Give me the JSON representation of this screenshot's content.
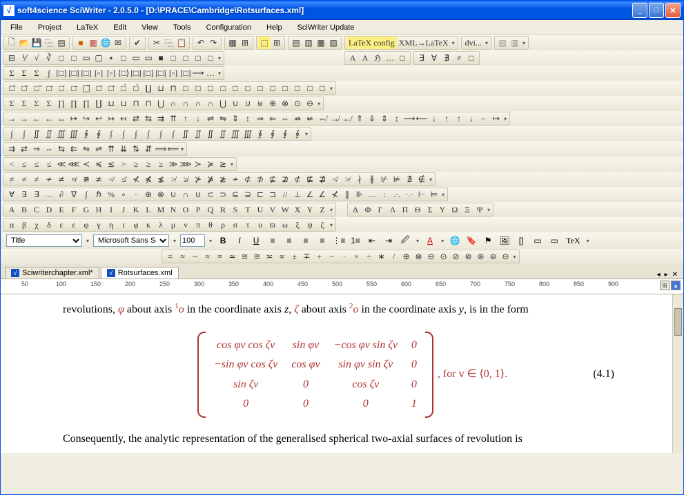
{
  "window": {
    "title": "soft4science SciWriter  -  2.0.5.0 -   [D:\\PRACE\\Cambridge\\Rotsurfaces.xml]"
  },
  "menu": {
    "items": [
      "File",
      "Project",
      "LaTeX",
      "Edit",
      "View",
      "Tools",
      "Configuration",
      "Help",
      "SciWriter Update"
    ]
  },
  "toolbar_main": {
    "latex_config": "LaTeX config",
    "xml_latex": "XML→LaTeX",
    "dvi": "dvi..."
  },
  "symbol_rows": [
    [
      "⊟",
      "⅟",
      "√",
      "∛",
      "□",
      "□",
      "▭",
      "▢",
      "▪",
      "□",
      "▭",
      "▭",
      "■",
      "□",
      "□",
      "□",
      "□"
    ],
    [
      "Σ",
      "Σ",
      "Σ",
      "∫",
      "[□]",
      "[□]",
      "[□]",
      "[▫]",
      "[▫]",
      "⟨□⟩",
      "[□]",
      "[□]",
      "[□]",
      "[▫]",
      "[□]",
      "⟶",
      "…"
    ],
    [
      "□̂",
      "□̌",
      "□̃",
      "□̄",
      "□̇",
      "□̈",
      "□⃗",
      "□̆",
      "□̊",
      "□́",
      "□̀",
      "∐",
      "⊔",
      "⊓",
      "□",
      "□",
      "□",
      "□",
      "□",
      "□",
      "□",
      "□",
      "□",
      "□",
      "□",
      "□"
    ],
    [
      "Σ",
      "Σ",
      "Σ",
      "Σ",
      "∏",
      "∏",
      "∏",
      "∐",
      "⊔",
      "⊔",
      "⊓",
      "⊓",
      "⋃",
      "∩",
      "∩",
      "∩",
      "∩",
      "⋃",
      "∪",
      "∪",
      "⊎",
      "⊕",
      "⊗",
      "⊙",
      "⊖"
    ],
    [
      "→",
      "→",
      "←",
      "←",
      "↔",
      "↦",
      "↪",
      "↩",
      "↣",
      "↢",
      "⇄",
      "⇆",
      "⇉",
      "⇈",
      "↑",
      "↓",
      "⇌",
      "⇋",
      "⇕",
      "↕",
      "⇒",
      "⇐",
      "⇔",
      "⇏",
      "⇍",
      "⇎",
      "↛",
      "↚",
      "⇑",
      "⇓",
      "⇕",
      "↕",
      "⟶",
      "⟵",
      "↓",
      "↑",
      "↑",
      "↓",
      "⌐",
      "↦"
    ],
    [
      "∫",
      "∫",
      "∬",
      "∬",
      "∭",
      "∭",
      "∮",
      "∮",
      "∫",
      "∫",
      "∫",
      "∫",
      "∫",
      "∫",
      "∬",
      "∬",
      "∬",
      "∬",
      "∭",
      "∭",
      "∮",
      "∮",
      "∮",
      "∮"
    ],
    [
      "⇉",
      "⇄",
      "⇒",
      "⇔",
      "⇆",
      "⇇",
      "⇋",
      "⇌",
      "⇈",
      "⇊",
      "⇅",
      "⇵",
      "⟹",
      "⟸"
    ],
    [
      "<",
      "≤",
      "≤",
      "≤",
      "≪",
      "⋘",
      "≺",
      "≼",
      "≲",
      ">",
      "≥",
      "≥",
      "≥",
      "≫",
      "⋙",
      "≻",
      "≽",
      "≳"
    ],
    [
      "≠",
      "≠",
      "≠",
      "≁",
      "≄",
      "≉",
      "≇",
      "≭",
      "≮",
      "≰",
      "⊀",
      "⋠",
      "≴",
      "≯",
      "≱",
      "⊁",
      "⋡",
      "≵",
      "≁",
      "⊄",
      "⊅",
      "⊈",
      "⊉",
      "⊄",
      "⋢",
      "⋣",
      "≮",
      "≯",
      "∤",
      "∦",
      "⊬",
      "⊭",
      "∄",
      "∉"
    ],
    [
      "∀",
      "∃",
      "∃",
      "…",
      "∂",
      "∇",
      "∫",
      "ℏ",
      "%",
      "∘",
      "·",
      "⊕",
      "⊗",
      "∪",
      "∩",
      "∪",
      "⊂",
      "⊃",
      "⊆",
      "⊇",
      "⊏",
      "⊐",
      "//",
      "⊥",
      "∠",
      "∠",
      "⊀",
      "∥",
      "⊪",
      "…",
      ":",
      ".·.",
      "·.·",
      "⊢",
      "⊨"
    ],
    [
      "A",
      "B",
      "C",
      "D",
      "E",
      "F",
      "G",
      "H",
      "I",
      "J",
      "K",
      "L",
      "M",
      "N",
      "O",
      "P",
      "Q",
      "R",
      "S",
      "T",
      "U",
      "V",
      "W",
      "X",
      "Y",
      "Z"
    ],
    [
      "α",
      "β",
      "χ",
      "δ",
      "ε",
      "ε",
      "φ",
      "γ",
      "η",
      "ι",
      "φ",
      "κ",
      "λ",
      "μ",
      "ν",
      "π",
      "θ",
      "ρ",
      "σ",
      "τ",
      "υ",
      "ϖ",
      "ω",
      "ξ",
      "ψ",
      "ζ"
    ]
  ],
  "greek_caps": [
    "Δ",
    "Φ",
    "Γ",
    "Λ",
    "Π",
    "Θ",
    "Σ",
    "Υ",
    "Ω",
    "Ξ",
    "Ψ"
  ],
  "math_fonts": [
    "A",
    "A",
    "ℌ",
    "…",
    "□"
  ],
  "quantifiers": [
    "∃",
    "∀",
    "∄",
    "≠",
    "□"
  ],
  "format": {
    "style": "Title",
    "font": "Microsoft Sans Serif",
    "size": "100",
    "tex_label": "TeX"
  },
  "math_ops_row": [
    "=",
    "≈",
    "~",
    "≈",
    "≡",
    "≃",
    "≅",
    "≊",
    "≍",
    "∝",
    "±",
    "∓",
    "+",
    "−",
    "·",
    "×",
    "÷",
    "∗",
    "/",
    "⊕",
    "⊗",
    "⊖",
    "⊙",
    "⊘",
    "⊚",
    "⊛",
    "⊜",
    "⊝"
  ],
  "tabs": [
    {
      "label": "Sciwriterchapter.xml*",
      "active": false
    },
    {
      "label": "Rotsurfaces.xml",
      "active": true
    }
  ],
  "ruler": {
    "marks": [
      "50",
      "100",
      "150",
      "200",
      "250",
      "300",
      "350",
      "400",
      "450",
      "500",
      "550",
      "600",
      "650",
      "700",
      "750",
      "800",
      "850",
      "900"
    ]
  },
  "document": {
    "line1_p1": "revolutions, ",
    "line1_phi": "φ",
    "line1_p2": " about axis ",
    "line1_sup1": "1",
    "line1_o1": "o",
    "line1_p3": " in the coordinate axis ",
    "line1_z": "z",
    "line1_p4": ", ",
    "line1_zeta": "ζ",
    "line1_p5": " about axis ",
    "line1_sup2": "2",
    "line1_o2": "o",
    "line1_p6": " in the coordinate axis ",
    "line1_y": "y",
    "line1_p7": ", is in the form",
    "matrix": [
      [
        "cos φv cos ζv",
        "sin φv",
        "−cos φv sin ζv",
        "0"
      ],
      [
        "−sin φv cos ζv",
        "cos φv",
        "sin φv sin ζv",
        "0"
      ],
      [
        "sin ζv",
        "0",
        "cos ζv",
        "0"
      ],
      [
        "0",
        "0",
        "0",
        "1"
      ]
    ],
    "matrix_suffix": ", for v ∈ ⟨0, 1⟩.",
    "eq_num": "(4.1)",
    "line2": "Consequently, the analytic representation of the generalised spherical two-axial surfaces of revolution is"
  }
}
